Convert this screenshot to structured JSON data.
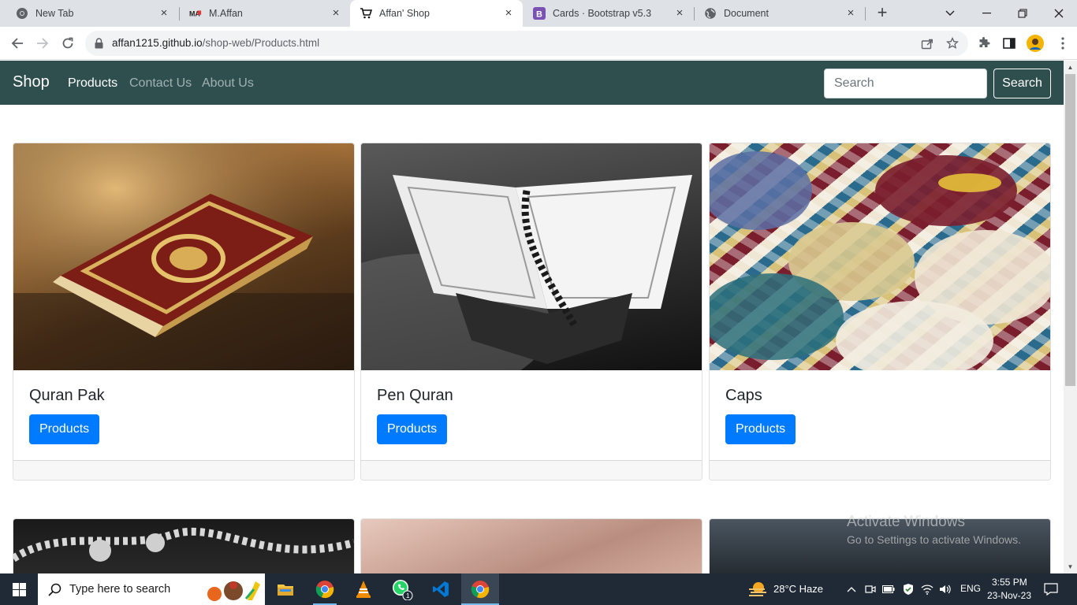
{
  "browser": {
    "tabs": [
      {
        "label": "New Tab",
        "icon": "chrome-icon",
        "active": false
      },
      {
        "label": "M.Affan",
        "icon": "ma-logo-icon",
        "active": false
      },
      {
        "label": "Affan' Shop",
        "icon": "cart-icon",
        "active": true
      },
      {
        "label": "Cards · Bootstrap v5.3",
        "icon": "bootstrap-icon",
        "active": false
      },
      {
        "label": "Document",
        "icon": "globe-icon",
        "active": false
      }
    ],
    "url_host": "affan1215.github.io",
    "url_path": "/shop-web/Products.html"
  },
  "navbar": {
    "brand": "Shop",
    "links": [
      {
        "label": "Products",
        "active": true
      },
      {
        "label": "Contact Us",
        "active": false
      },
      {
        "label": "About Us",
        "active": false
      }
    ],
    "search_placeholder": "Search",
    "search_button": "Search",
    "bg_color": "#2f4f4f"
  },
  "products": [
    {
      "title": "Quran Pak",
      "button": "Products",
      "image": "quran-book-image"
    },
    {
      "title": "Pen Quran",
      "button": "Products",
      "image": "open-quran-on-stand-image"
    },
    {
      "title": "Caps",
      "button": "Products",
      "image": "prayer-caps-image"
    }
  ],
  "watermark": {
    "line1": "Activate Windows",
    "line2": "Go to Settings to activate Windows."
  },
  "taskbar": {
    "search_placeholder": "Type here to search",
    "weather": "28°C  Haze",
    "language": "ENG",
    "time": "3:55 PM",
    "date": "23-Nov-23",
    "whatsapp_badge": "1"
  },
  "colors": {
    "primary_button": "#007bff",
    "taskbar": "#1f2a36"
  }
}
